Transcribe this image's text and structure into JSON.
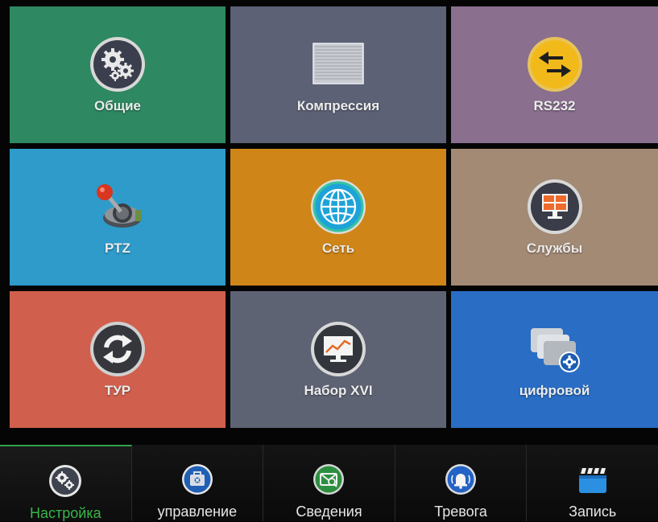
{
  "tiles": [
    {
      "label": "Общие",
      "icon": "gears-icon",
      "color": "#2e8861"
    },
    {
      "label": "Компрессия",
      "icon": "compression-icon",
      "color": "#5c6175"
    },
    {
      "label": "RS232",
      "icon": "arrows-swap-icon",
      "color": "#8a6f8f"
    },
    {
      "label": "PTZ",
      "icon": "joystick-icon",
      "color": "#2e9bcb"
    },
    {
      "label": "Сеть",
      "icon": "globe-icon",
      "color": "#cf8518"
    },
    {
      "label": "Службы",
      "icon": "monitor-icon",
      "color": "#a38a74"
    },
    {
      "label": "ТУР",
      "icon": "refresh-icon",
      "color": "#d0604d"
    },
    {
      "label": "Набор XVI",
      "icon": "chart-monitor-icon",
      "color": "#5e6374"
    },
    {
      "label": "цифровой",
      "icon": "digital-channels-icon",
      "color": "#2a6dc4"
    }
  ],
  "tabs": [
    {
      "label": "Настройка",
      "icon": "gears-icon",
      "active": true,
      "accent": "#39b54a"
    },
    {
      "label": "управление",
      "icon": "toolbox-icon",
      "active": false
    },
    {
      "label": "Сведения",
      "icon": "info-icon",
      "active": false
    },
    {
      "label": "Тревога",
      "icon": "alarm-bell-icon",
      "active": false
    },
    {
      "label": "Запись",
      "icon": "clapper-icon",
      "active": false
    }
  ]
}
